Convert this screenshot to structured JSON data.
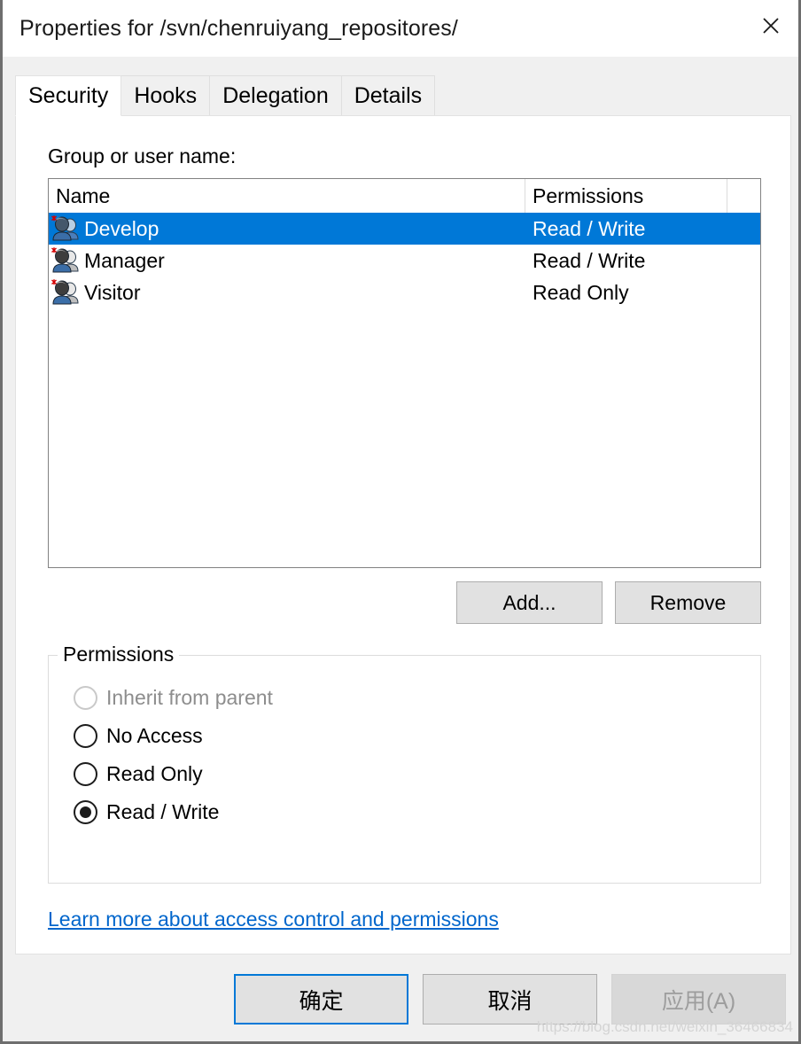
{
  "window": {
    "title": "Properties for /svn/chenruiyang_repositores/",
    "close_icon": "close-icon"
  },
  "tabs": [
    {
      "label": "Security",
      "active": true
    },
    {
      "label": "Hooks",
      "active": false
    },
    {
      "label": "Delegation",
      "active": false
    },
    {
      "label": "Details",
      "active": false
    }
  ],
  "security": {
    "list_label": "Group or user name:",
    "columns": [
      "Name",
      "Permissions"
    ],
    "rows": [
      {
        "icon": "group-users-icon",
        "name": "Develop",
        "permissions": "Read / Write",
        "selected": true
      },
      {
        "icon": "group-users-icon",
        "name": "Manager",
        "permissions": "Read / Write",
        "selected": false
      },
      {
        "icon": "group-users-icon",
        "name": "Visitor",
        "permissions": "Read Only",
        "selected": false
      }
    ],
    "add_label": "Add...",
    "remove_label": "Remove",
    "permissions_group_label": "Permissions",
    "permission_options": [
      {
        "label": "Inherit from parent",
        "checked": false,
        "disabled": true
      },
      {
        "label": "No Access",
        "checked": false,
        "disabled": false
      },
      {
        "label": "Read Only",
        "checked": false,
        "disabled": false
      },
      {
        "label": "Read / Write",
        "checked": true,
        "disabled": false
      }
    ],
    "learn_more_link": "Learn more about access control and permissions"
  },
  "footer": {
    "ok_label": "确定",
    "cancel_label": "取消",
    "apply_label": "应用(A)",
    "apply_disabled": true
  },
  "watermark": "https://blog.csdn.net/weixin_36466834",
  "colors": {
    "selection_blue": "#0078d7",
    "link_blue": "#0066cc",
    "button_face": "#e1e1e1",
    "dialog_face": "#f0f0f0"
  }
}
